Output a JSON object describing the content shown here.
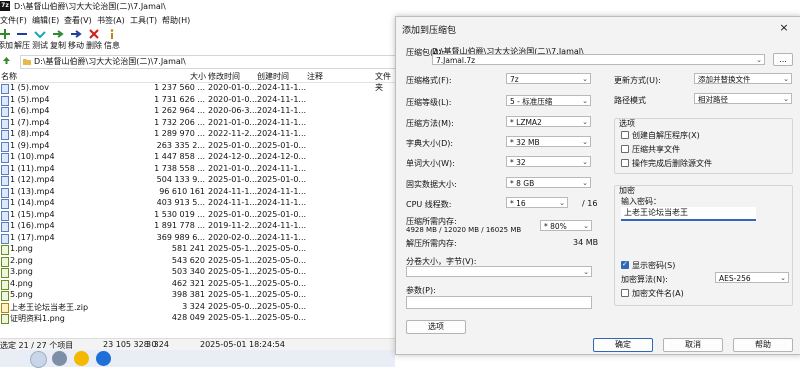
{
  "fm": {
    "title": "D:\\基督山伯爵\\习大大论治国(二)\\7.Jamal\\",
    "app_icon": "7z",
    "menu": [
      "文件(F)",
      "编辑(E)",
      "查看(V)",
      "书签(A)",
      "工具(T)",
      "帮助(H)"
    ],
    "toolbar": [
      {
        "label": "添加",
        "icon": "plus-icon"
      },
      {
        "label": "解压",
        "icon": "minus-icon"
      },
      {
        "label": "测试",
        "icon": "check-icon"
      },
      {
        "label": "复制",
        "icon": "copy-arrow-icon"
      },
      {
        "label": "移动",
        "icon": "move-arrow-icon"
      },
      {
        "label": "删除",
        "icon": "delete-x-icon"
      },
      {
        "label": "信息",
        "icon": "info-icon"
      }
    ],
    "address": "D:\\基督山伯爵\\习大大论治国(二)\\7.Jamal\\",
    "columns": {
      "name": "名称",
      "size": "大小",
      "modified": "修改时间",
      "created": "创建时间",
      "comment": "注释",
      "folder": "文件夹"
    },
    "files": [
      {
        "name": "1 (5).mov",
        "size": "1 237 560 ...",
        "modified": "2020-01-0...",
        "created": "2024-11-1...",
        "type": "video"
      },
      {
        "name": "1 (5).mp4",
        "size": "1 731 626 ...",
        "modified": "2020-01-0...",
        "created": "2024-11-1...",
        "type": "video"
      },
      {
        "name": "1 (6).mp4",
        "size": "1 262 964 ...",
        "modified": "2020-06-3...",
        "created": "2024-11-1...",
        "type": "video"
      },
      {
        "name": "1 (7).mp4",
        "size": "1 732 206 ...",
        "modified": "2021-01-0...",
        "created": "2024-11-1...",
        "type": "video"
      },
      {
        "name": "1 (8).mp4",
        "size": "1 289 970 ...",
        "modified": "2022-11-2...",
        "created": "2024-11-1...",
        "type": "video"
      },
      {
        "name": "1 (9).mp4",
        "size": "263 335 2...",
        "modified": "2025-01-0...",
        "created": "2025-01-0...",
        "type": "video"
      },
      {
        "name": "1 (10).mp4",
        "size": "1 447 858 ...",
        "modified": "2024-12-0...",
        "created": "2024-12-0...",
        "type": "video"
      },
      {
        "name": "1 (11).mp4",
        "size": "1 738 558 ...",
        "modified": "2021-01-0...",
        "created": "2024-11-1...",
        "type": "video"
      },
      {
        "name": "1 (12).mp4",
        "size": "504 133 9...",
        "modified": "2025-01-0...",
        "created": "2025-01-0...",
        "type": "video"
      },
      {
        "name": "1 (13).mp4",
        "size": "96 610 161",
        "modified": "2024-11-1...",
        "created": "2024-11-1...",
        "type": "video"
      },
      {
        "name": "1 (14).mp4",
        "size": "403 913 5...",
        "modified": "2024-11-1...",
        "created": "2024-11-1...",
        "type": "video"
      },
      {
        "name": "1 (15).mp4",
        "size": "1 530 019 ...",
        "modified": "2025-01-0...",
        "created": "2025-01-0...",
        "type": "video"
      },
      {
        "name": "1 (16).mp4",
        "size": "1 891 778 ...",
        "modified": "2019-11-2...",
        "created": "2024-11-1...",
        "type": "video"
      },
      {
        "name": "1 (17).mp4",
        "size": "369 989 6...",
        "modified": "2020-02-0...",
        "created": "2024-11-1...",
        "type": "video"
      },
      {
        "name": "1.png",
        "size": "581 241",
        "modified": "2025-05-1...",
        "created": "2025-05-0...",
        "type": "png"
      },
      {
        "name": "2.png",
        "size": "543 620",
        "modified": "2025-05-1...",
        "created": "2025-05-0...",
        "type": "png"
      },
      {
        "name": "3.png",
        "size": "503 340",
        "modified": "2025-05-1...",
        "created": "2025-05-0...",
        "type": "png"
      },
      {
        "name": "4.png",
        "size": "462 321",
        "modified": "2025-05-1...",
        "created": "2025-05-0...",
        "type": "png"
      },
      {
        "name": "5.png",
        "size": "398 381",
        "modified": "2025-05-1...",
        "created": "2025-05-0...",
        "type": "png"
      },
      {
        "name": "上老王论坛当老王.zip",
        "size": "3 324",
        "modified": "2025-05-0...",
        "created": "2025-05-0...",
        "type": "zip"
      },
      {
        "name": "证明资料1.png",
        "size": "428 049",
        "modified": "2025-05-1...",
        "created": "2025-05-0...",
        "type": "png"
      }
    ],
    "status": {
      "selected": "选定 21 / 27 个项目",
      "total_size": "23 105 328 0",
      "packed": "3 324",
      "date": "2025-05-01 18:24:54"
    }
  },
  "dialog": {
    "title": "添加到压缩包",
    "close": "×",
    "archive_label": "压缩包(A):",
    "archive_path": "D:\\基督山伯爵\\习大大论治国(二)\\7.Jamal\\",
    "archive_name": "7.Jamal.7z",
    "browse": "...",
    "format_label": "压缩格式(F):",
    "format_value": "7z",
    "level_label": "压缩等级(L):",
    "level_value": "5 - 标准压缩",
    "method_label": "压缩方法(M):",
    "method_value": "* LZMA2",
    "dict_label": "字典大小(D):",
    "dict_value": "* 32 MB",
    "word_label": "单词大小(W):",
    "word_value": "* 32",
    "solid_label": "固实数据大小:",
    "solid_value": "* 8 GB",
    "cpu_label": "CPU 线程数:",
    "cpu_value": "* 16",
    "cpu_total": "/ 16",
    "mem_label": "压缩所需内存:",
    "mem_value": "4928 MB / 12020 MB / 16025 MB",
    "mem_pct": "* 80%",
    "decomp_label": "解压所需内存:",
    "decomp_value": "34 MB",
    "split_label": "分卷大小，字节(V):",
    "split_value": "",
    "params_label": "参数(P):",
    "params_value": "",
    "options_button": "选项",
    "update_label": "更新方式(U):",
    "update_value": "添加并替换文件",
    "pathmode_label": "路径模式",
    "pathmode_value": "相对路径",
    "options_group": "选项",
    "opt_sfx": "创建自解压程序(X)",
    "opt_shared": "压缩共享文件",
    "opt_delete": "操作完成后删除源文件",
    "encrypt_group": "加密",
    "password_label": "输入密码：",
    "password_value": "上老王论坛当老王",
    "show_password": "显示密码(S)",
    "enc_method_label": "加密算法(N):",
    "enc_method_value": "AES-256",
    "enc_names": "加密文件名(A)",
    "ok": "确定",
    "cancel": "取消",
    "help": "帮助"
  },
  "colors": {
    "accent": "#2f68b8",
    "dialog_bg": "#f3f3f3"
  }
}
